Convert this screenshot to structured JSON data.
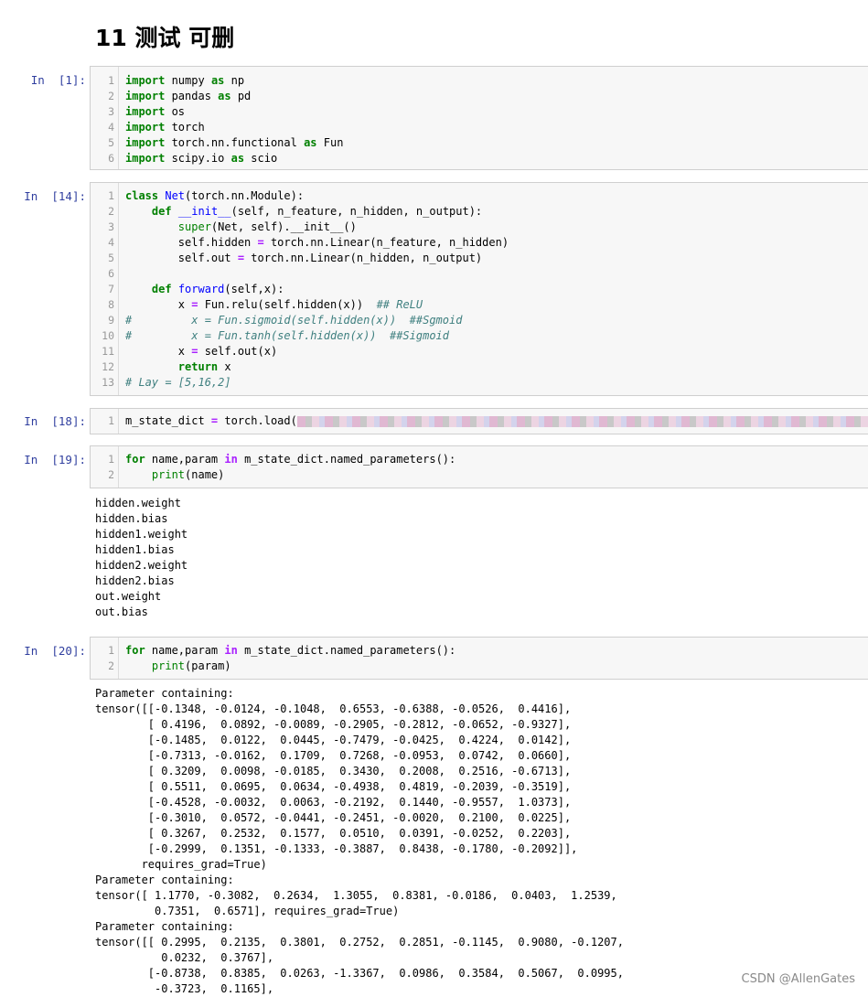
{
  "heading": "11 测试 可删",
  "cells": [
    {
      "prompt": "In  [1]:",
      "lines": [
        "<span class=\"kw\">import</span> numpy <span class=\"kw\">as</span> np",
        "<span class=\"kw\">import</span> pandas <span class=\"kw\">as</span> pd",
        "<span class=\"kw\">import</span> os",
        "<span class=\"kw\">import</span> torch",
        "<span class=\"kw\">import</span> torch.nn.functional <span class=\"kw\">as</span> Fun",
        "<span class=\"kw\">import</span> scipy.io <span class=\"kw\">as</span> scio"
      ]
    },
    {
      "prompt": "In  [14]:",
      "lines": [
        "<span class=\"kw\">class</span> <span class=\"fn\">Net</span>(torch.nn.Module):",
        "    <span class=\"kw\">def</span> <span class=\"fn\">__init__</span>(self, n_feature, n_hidden, n_output):",
        "        <span class=\"bi\">super</span>(Net, self).__init__()",
        "        self.hidden <span class=\"op\">=</span> torch.nn.Linear(n_feature, n_hidden)",
        "        self.out <span class=\"op\">=</span> torch.nn.Linear(n_hidden, n_output)",
        "",
        "    <span class=\"kw\">def</span> <span class=\"fn\">forward</span>(self,x):",
        "        x <span class=\"op\">=</span> Fun.relu(self.hidden(x))  <span class=\"cm\">## ReLU</span>",
        "<span class=\"cm\">#         x = Fun.sigmoid(self.hidden(x))  ##Sgmoid</span>",
        "<span class=\"cm\">#         x = Fun.tanh(self.hidden(x))  ##Sigmoid</span>",
        "        x <span class=\"op\">=</span> self.out(x)",
        "        <span class=\"kw\">return</span> x",
        "<span class=\"cm\"># Lay = [5,16,2]</span>"
      ]
    },
    {
      "prompt": "In  [18]:",
      "lines": [
        "m_state_dict <span class=\"op\">=</span> torch.load(<span class=\"redact\" style=\"width:640px;background:repeating-linear-gradient(90deg,#d9a3c6 0 9px,#b9b9b9 9px 16px,#e8c9db 16px 24px,#c7c7e8 24px 30px);opacity:.75\"></span><span style=\"color:#ba2121\">_.pt')</span>"
      ]
    },
    {
      "prompt": "In  [19]:",
      "lines": [
        "<span class=\"kw\">for</span> name,param <span class=\"op\">in</span> m_state_dict.named_parameters():",
        "    <span class=\"bi\">print</span>(name)"
      ]
    },
    {
      "prompt": "In  [20]:",
      "lines": [
        "<span class=\"kw\">for</span> name,param <span class=\"op\">in</span> m_state_dict.named_parameters():",
        "    <span class=\"bi\">print</span>(param)"
      ]
    }
  ],
  "outputs": {
    "names": "hidden.weight\nhidden.bias\nhidden1.weight\nhidden1.bias\nhidden2.weight\nhidden2.bias\nout.weight\nout.bias",
    "params": "Parameter containing:\ntensor([[-0.1348, -0.0124, -0.1048,  0.6553, -0.6388, -0.0526,  0.4416],\n        [ 0.4196,  0.0892, -0.0089, -0.2905, -0.2812, -0.0652, -0.9327],\n        [-0.1485,  0.0122,  0.0445, -0.7479, -0.0425,  0.4224,  0.0142],\n        [-0.7313, -0.0162,  0.1709,  0.7268, -0.0953,  0.0742,  0.0660],\n        [ 0.3209,  0.0098, -0.0185,  0.3430,  0.2008,  0.2516, -0.6713],\n        [ 0.5511,  0.0695,  0.0634, -0.4938,  0.4819, -0.2039, -0.3519],\n        [-0.4528, -0.0032,  0.0063, -0.2192,  0.1440, -0.9557,  1.0373],\n        [-0.3010,  0.0572, -0.0441, -0.2451, -0.0020,  0.2100,  0.0225],\n        [ 0.3267,  0.2532,  0.1577,  0.0510,  0.0391, -0.0252,  0.2203],\n        [-0.2999,  0.1351, -0.1333, -0.3887,  0.8438, -0.1780, -0.2092]],\n       requires_grad=True)\nParameter containing:\ntensor([ 1.1770, -0.3082,  0.2634,  1.3055,  0.8381, -0.0186,  0.0403,  1.2539,\n         0.7351,  0.6571], requires_grad=True)\nParameter containing:\ntensor([[ 0.2995,  0.2135,  0.3801,  0.2752,  0.2851, -0.1145,  0.9080, -0.1207,\n          0.0232,  0.3767],\n        [-0.8738,  0.8385,  0.0263, -1.3367,  0.0986,  0.3584,  0.5067,  0.0995,\n         -0.3723,  0.1165],"
  },
  "watermark": "CSDN @AllenGates"
}
